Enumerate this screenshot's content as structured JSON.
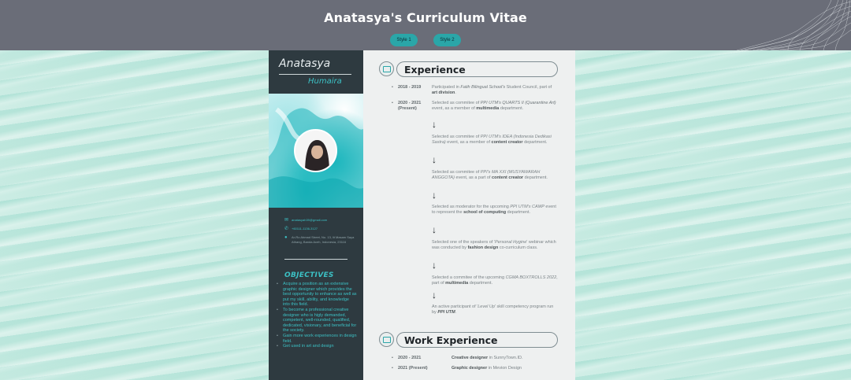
{
  "header": {
    "title": "Anatasya's Curriculum Vitae",
    "buttons": [
      "Style 1",
      "Style 2"
    ]
  },
  "sidebar": {
    "first_name": "Anatasya",
    "last_name": "Humaira",
    "contact": {
      "email": "anatasyah39@gmail.com",
      "phone": "+60111-1136-3127",
      "address": "Ar-Ro Ahmad Street, No. 13, lit Masam Saya Athang, Banda Aceh, Indonesia, 23116"
    },
    "objectives_title": "OBJECTIVES",
    "objectives": [
      "Acquire a position as an extensive graphic designer which provides the best opportunity to enhance as well as put my skill, ability, and knowledge into this field.",
      "To become a professional creative designer who is higly demanded, competent, well-rounded, qualified, dedicated, visionary, and beneficial for the society.",
      "Gain more work experiences in design field.",
      "Get used in art and design"
    ]
  },
  "experience": {
    "title": "Experience",
    "entries": [
      {
        "date": "2018 - 2019",
        "desc_html": "Participated in <i>Fatih Bilingual School's</i> Student Council, part of <b>art division</b>."
      },
      {
        "date": "2020 - 2021 (Present)",
        "desc_html": "Selected as commitee of <i>PPI UTM's QUARTS II (Quarantine Art)</i> event, as a member of <b>multimedia</b> department."
      }
    ],
    "steps": [
      "Selected as commitee of <i>PPI UTM's IDEA (Indonesia Dedikasi Sastra)</i> event, as a member of <b>content creator</b> department.",
      "Selected as commitee of <i>PPI's MA XXI (MUSYAWARAH ANGGOTA)</i> event, as a part of <b>content creator</b> department.",
      "Selected as moderator for the upcoming <i>PPI UTM's CAMP</i> event to represent the <b>school of computing</b> department.",
      "Selected one of the speakers of '<i>Personal Hygine</i>' webinar which was conducted by <b>fashion design</b> co-curriculum class.",
      "Selected a commitee of the upcoming <i>CGMA BOXTROLLS 2022</i>, part of <b>multimedia</b> department.",
      "An active participant of '<i>Level Up</i>' skill competency program run by <b><i>PPI UTM</i></b>."
    ],
    "arrow_glyph": "↓",
    "bullet": "•"
  },
  "work": {
    "title": "Work Experience",
    "entries": [
      {
        "date": "2020 - 2021",
        "desc_html": "<b>Creative designer</b> in SunnyTown.ID."
      },
      {
        "date": "2021 (Present)",
        "desc_html": "<b>Graphic designer</b> in Mevion Design"
      }
    ]
  },
  "icons": {
    "email": "email-icon",
    "phone": "phone-icon",
    "location": "location-pin-icon",
    "section": "briefcase-icon"
  },
  "colors": {
    "header_bg": "#6a6d78",
    "accent": "#2aa6a8",
    "sidebar_bg": "#2e3a40",
    "teal_text": "#3cc0c4",
    "main_bg": "#eef0f0"
  }
}
